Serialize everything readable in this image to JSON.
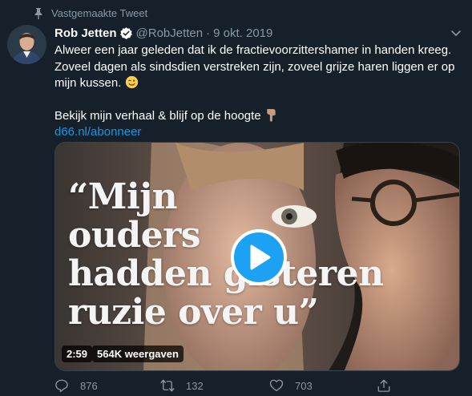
{
  "pinned": {
    "label": "Vastgemaakte Tweet",
    "icon": "pin-icon"
  },
  "author": {
    "name": "Rob Jetten",
    "handle": "@RobJetten",
    "separator": "·",
    "date": "9 okt. 2019",
    "verified": true
  },
  "tweet": {
    "line1": "Alweer een jaar geleden dat ik de fractievoorzittershamer in handen kreeg.",
    "line2": "Zoveel dagen als sindsdien verstreken zijn, zoveel grijze haren liggen er op",
    "line3": "mijn kussen.",
    "line4": "Bekijk mijn verhaal & blijf op de hoogte",
    "link": "d66.nl/abonneer"
  },
  "media": {
    "quote_lines": [
      "“Mijn",
      "ouders",
      "hadden gisteren",
      "ruzie over u”"
    ],
    "duration": "2:59",
    "views": "564K weergaven"
  },
  "actions": {
    "replies": "876",
    "retweets": "132",
    "likes": "703"
  },
  "colors": {
    "background": "#15202b",
    "secondary_text": "#8899a6",
    "link": "#1b95e0",
    "accent": "#1da1f2"
  }
}
